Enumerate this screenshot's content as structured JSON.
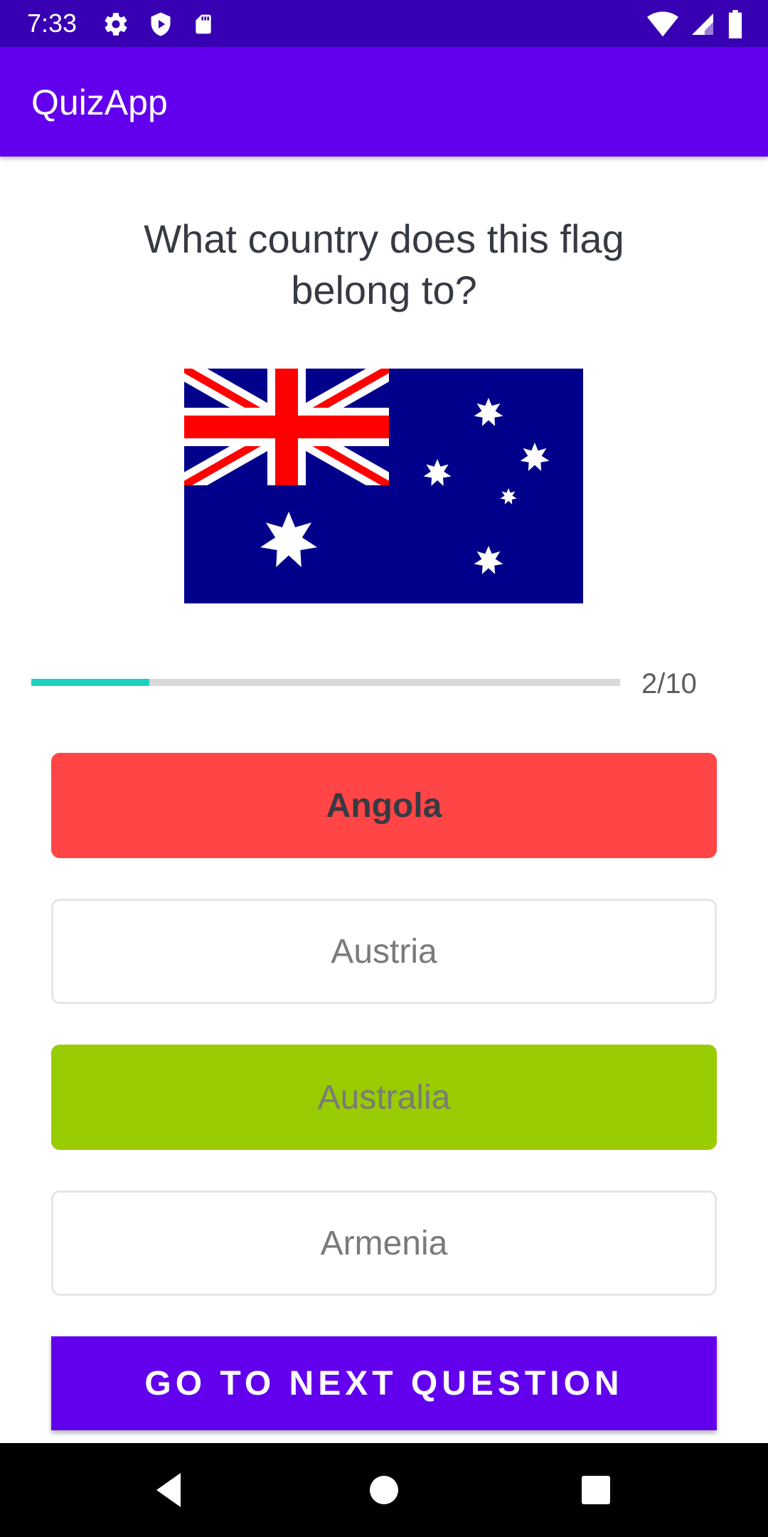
{
  "status_bar": {
    "time": "7:33",
    "left_icons": [
      "gear-icon",
      "shield-icon",
      "sd-card-icon"
    ],
    "right_icons": [
      "wifi-icon",
      "signal-icon",
      "battery-icon"
    ]
  },
  "app_bar": {
    "title": "QuizApp"
  },
  "question": {
    "text": "What country does this flag belong to?",
    "flag_icon": "australia-flag-icon"
  },
  "progress": {
    "current": 2,
    "total": 10,
    "label": "2/10",
    "fraction": 0.2
  },
  "options": [
    {
      "label": "Angola",
      "state": "wrong"
    },
    {
      "label": "Austria",
      "state": "default"
    },
    {
      "label": "Australia",
      "state": "correct"
    },
    {
      "label": "Armenia",
      "state": "default"
    }
  ],
  "next_button": {
    "label": "GO TO NEXT QUESTION"
  },
  "colors": {
    "primary": "#6200ee",
    "status_bar": "#3700b3",
    "wrong": "#ff4545",
    "correct": "#99cc00",
    "progress": "#1bd1c0"
  },
  "nav_bar": {
    "icons": [
      "back-icon",
      "home-icon",
      "recents-icon"
    ]
  }
}
